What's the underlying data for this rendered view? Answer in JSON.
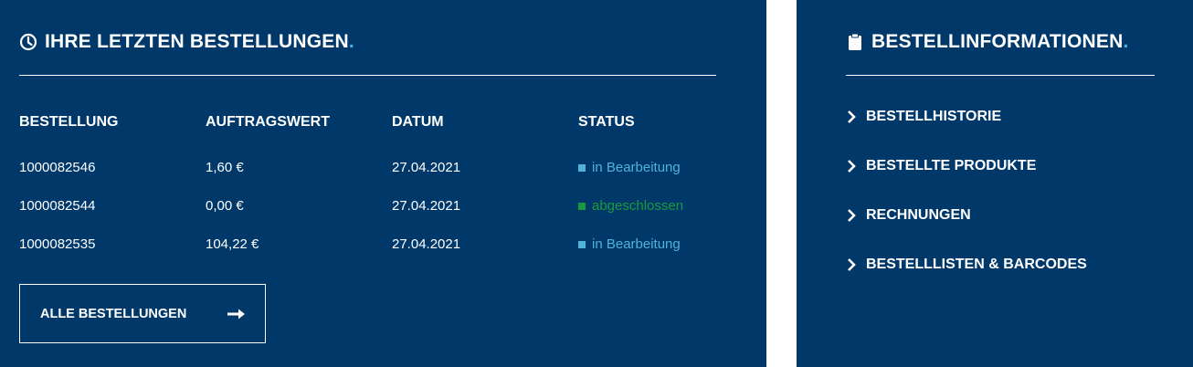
{
  "orders_panel": {
    "title": "IHRE LETZTEN BESTELLUNGEN",
    "title_dot": ".",
    "icon": "clock-icon",
    "columns": [
      "BESTELLUNG",
      "AUFTRAGSWERT",
      "DATUM",
      "STATUS"
    ],
    "rows": [
      {
        "order": "1000082546",
        "value": "1,60 €",
        "date": "27.04.2021",
        "status": "in Bearbeitung",
        "status_color": "#4fb3d9"
      },
      {
        "order": "1000082544",
        "value": "0,00 €",
        "date": "27.04.2021",
        "status": "abgeschlossen",
        "status_color": "#1a9a3c"
      },
      {
        "order": "1000082535",
        "value": "104,22 €",
        "date": "27.04.2021",
        "status": "in Bearbeitung",
        "status_color": "#4fb3d9"
      }
    ],
    "button_label": "ALLE BESTELLUNGEN",
    "button_icon": "arrow-right-icon"
  },
  "info_panel": {
    "title": "BESTELLINFORMATIONEN",
    "title_dot": ".",
    "icon": "clipboard-icon",
    "links": [
      {
        "label": "BESTELLHISTORIE"
      },
      {
        "label": "BESTELLTE PRODUKTE"
      },
      {
        "label": "RECHNUNGEN"
      },
      {
        "label": "BESTELLLISTEN & BARCODES"
      }
    ]
  },
  "colors": {
    "panel_bg": "#00386a",
    "accent_dot": "#4fb3d9",
    "status_processing": "#4fb3d9",
    "status_done": "#1a9a3c"
  }
}
